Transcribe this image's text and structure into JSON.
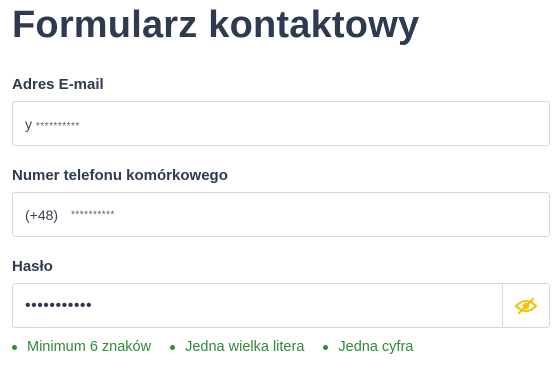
{
  "form": {
    "title": "Formularz kontaktowy",
    "email": {
      "label": "Adres E-mail",
      "value_prefix": "y",
      "value_masked": "**********"
    },
    "phone": {
      "label": "Numer telefonu komórkowego",
      "country_code": "(+48)",
      "value_masked": "**********"
    },
    "password": {
      "label": "Hasło",
      "value_masked": "•••••••••••",
      "toggle_icon": "eye-slash-icon",
      "toggle_color": "#f2c200"
    },
    "rules": [
      {
        "text": "Minimum 6 znaków"
      },
      {
        "text": "Jedna wielka litera"
      },
      {
        "text": "Jedna cyfra"
      }
    ],
    "rule_color": "#2e8b3a"
  }
}
